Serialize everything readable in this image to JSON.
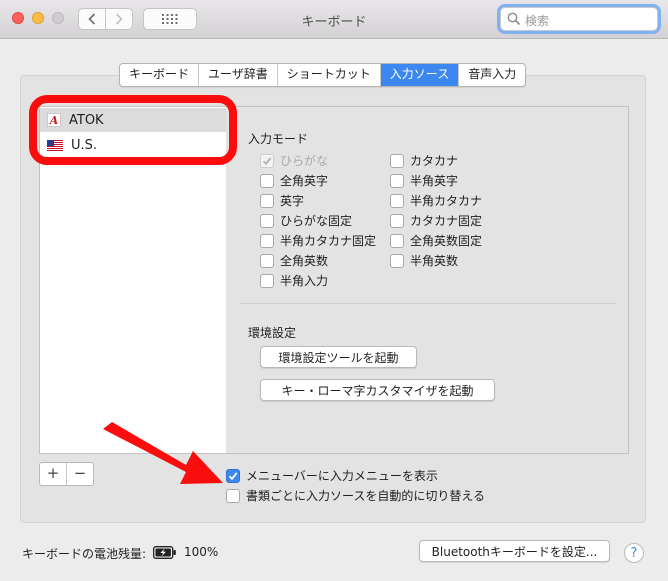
{
  "window": {
    "title": "キーボード",
    "search_placeholder": "検索"
  },
  "tabs": [
    {
      "label": "キーボード",
      "active": false
    },
    {
      "label": "ユーザ辞書",
      "active": false
    },
    {
      "label": "ショートカット",
      "active": false
    },
    {
      "label": "入力ソース",
      "active": true
    },
    {
      "label": "音声入力",
      "active": false
    }
  ],
  "sources": [
    {
      "label": "ATOK",
      "icon": "atok-icon",
      "selected": true
    },
    {
      "label": "U.S.",
      "icon": "us-flag-icon",
      "selected": false
    }
  ],
  "input_mode": {
    "heading": "入力モード",
    "left": [
      {
        "label": "ひらがな",
        "checked": true,
        "disabled": true
      },
      {
        "label": "全角英字",
        "checked": false
      },
      {
        "label": "英字",
        "checked": false
      },
      {
        "label": "ひらがな固定",
        "checked": false
      },
      {
        "label": "半角カタカナ固定",
        "checked": false
      },
      {
        "label": "全角英数",
        "checked": false
      },
      {
        "label": "半角入力",
        "checked": false
      }
    ],
    "right": [
      {
        "label": "カタカナ",
        "checked": false
      },
      {
        "label": "半角英字",
        "checked": false
      },
      {
        "label": "半角カタカナ",
        "checked": false
      },
      {
        "label": "カタカナ固定",
        "checked": false
      },
      {
        "label": "全角英数固定",
        "checked": false
      },
      {
        "label": "半角英数",
        "checked": false
      }
    ]
  },
  "env": {
    "heading": "環境設定",
    "tool_button": "環境設定ツールを起動",
    "romaji_button": "キー・ローマ字カスタマイザを起動"
  },
  "list_controls": {
    "add": "+",
    "remove": "−"
  },
  "options": {
    "show_menu": {
      "label": "メニューバーに入力メニューを表示",
      "checked": true
    },
    "auto_switch": {
      "label": "書類ごとに入力ソースを自動的に切り替える",
      "checked": false
    }
  },
  "footer": {
    "battery_label": "キーボードの電池残量:",
    "battery_percent": "100%",
    "bluetooth_button": "Bluetoothキーボードを設定...",
    "help": "?"
  },
  "colors": {
    "accent": "#3d88f0",
    "annotation": "#fb0d0d"
  }
}
